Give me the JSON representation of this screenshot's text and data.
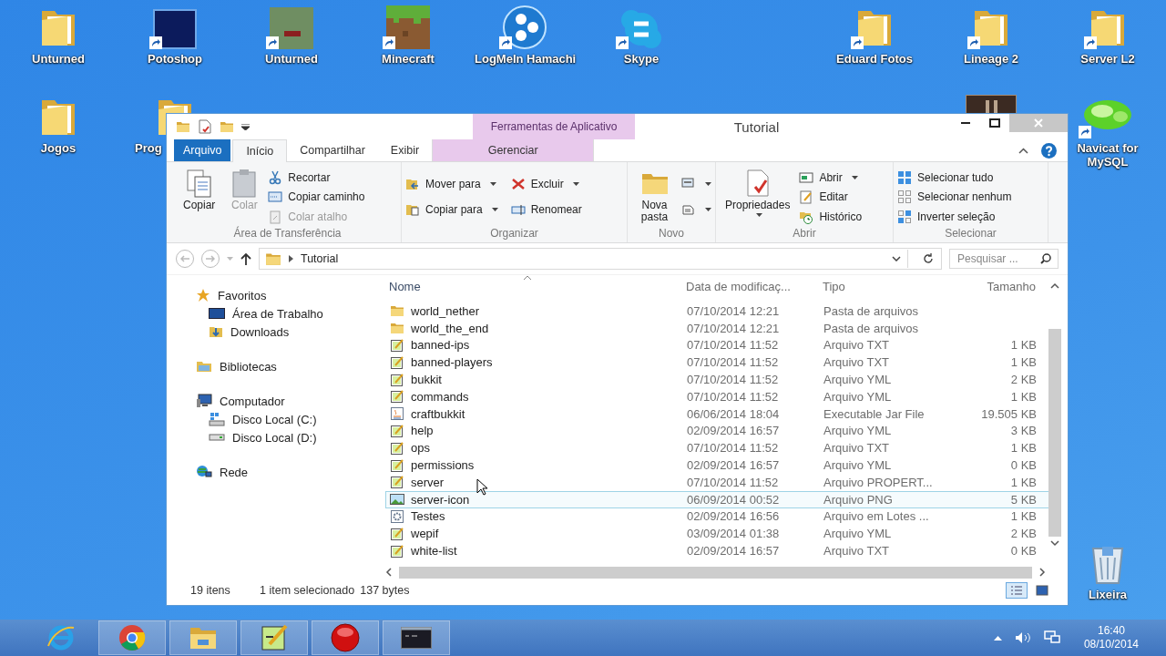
{
  "desktop_icons": [
    {
      "label": "Unturned",
      "kind": "folder",
      "shortcut": false
    },
    {
      "label": "Potoshop",
      "kind": "photoshop",
      "shortcut": true
    },
    {
      "label": "Unturned",
      "kind": "unturned",
      "shortcut": true
    },
    {
      "label": "Minecraft",
      "kind": "minecraft",
      "shortcut": true
    },
    {
      "label": "LogMeIn Hamachi",
      "kind": "hamachi",
      "shortcut": true
    },
    {
      "label": "Skype",
      "kind": "skype",
      "shortcut": true
    },
    {
      "label": "Eduard Fotos",
      "kind": "folder",
      "shortcut": true
    },
    {
      "label": "Lineage 2",
      "kind": "folder",
      "shortcut": true
    },
    {
      "label": "Server L2",
      "kind": "folder",
      "shortcut": true
    },
    {
      "label": "Jogos",
      "kind": "folder",
      "shortcut": false
    },
    {
      "label": "Prog",
      "kind": "folder",
      "shortcut": false
    },
    {
      "kind": "game"
    },
    {
      "label": "Navicat for MySQL",
      "kind": "navicat",
      "shortcut": true
    },
    {
      "label": "Lixeira",
      "kind": "recycle",
      "shortcut": false
    }
  ],
  "window": {
    "title": "Tutorial",
    "context_header": "Ferramentas de Aplicativo",
    "tabs": [
      {
        "label": "Arquivo",
        "kind": "file",
        "selected": false
      },
      {
        "label": "Início",
        "kind": "tab",
        "selected": true
      },
      {
        "label": "Compartilhar",
        "kind": "tab",
        "selected": false
      },
      {
        "label": "Exibir",
        "kind": "tab",
        "selected": false
      },
      {
        "label": "Gerenciar",
        "kind": "context",
        "selected": false
      }
    ],
    "ribbon": [
      {
        "name": "Área de Transferência",
        "items": [
          {
            "label": "Copiar",
            "kind": "large",
            "disabled": false,
            "dropdown": false
          },
          {
            "label": "Colar",
            "kind": "large",
            "disabled": true,
            "dropdown": false
          },
          {
            "label": "Recortar",
            "kind": "small",
            "disabled": false,
            "dropdown": false
          },
          {
            "label": "Copiar caminho",
            "kind": "small",
            "disabled": false,
            "dropdown": false
          },
          {
            "label": "Colar atalho",
            "kind": "small",
            "disabled": true,
            "dropdown": false
          }
        ]
      },
      {
        "name": "Organizar",
        "items": [
          {
            "label": "Mover para",
            "kind": "small",
            "disabled": false,
            "dropdown": true
          },
          {
            "label": "Copiar para",
            "kind": "small",
            "disabled": false,
            "dropdown": true
          },
          {
            "label": "Excluir",
            "kind": "small",
            "disabled": false,
            "dropdown": true
          },
          {
            "label": "Renomear",
            "kind": "small",
            "disabled": false,
            "dropdown": false
          }
        ]
      },
      {
        "name": "Novo",
        "items": [
          {
            "label": "Nova pasta",
            "kind": "large",
            "disabled": false,
            "dropdown": false
          },
          {
            "kind": "icon",
            "disabled": false,
            "dropdown": true
          },
          {
            "kind": "icon",
            "disabled": false,
            "dropdown": true
          }
        ]
      },
      {
        "name": "Abrir",
        "items": [
          {
            "label": "Propriedades",
            "kind": "large",
            "disabled": false,
            "dropdown": true
          },
          {
            "label": "Abrir",
            "kind": "small",
            "disabled": false,
            "dropdown": true
          },
          {
            "label": "Editar",
            "kind": "small",
            "disabled": false,
            "dropdown": false
          },
          {
            "label": "Histórico",
            "kind": "small",
            "disabled": false,
            "dropdown": false
          }
        ]
      },
      {
        "name": "Selecionar",
        "items": [
          {
            "label": "Selecionar tudo",
            "kind": "small",
            "disabled": false,
            "dropdown": false
          },
          {
            "label": "Selecionar nenhum",
            "kind": "small",
            "disabled": false,
            "dropdown": false
          },
          {
            "label": "Inverter seleção",
            "kind": "small",
            "disabled": false,
            "dropdown": false
          }
        ]
      }
    ],
    "address": {
      "path": [
        "Tutorial"
      ],
      "search_placeholder": "Pesquisar ..."
    },
    "navigation": [
      {
        "label": "Favoritos",
        "kind": "favorites",
        "children": [
          {
            "label": "Área de Trabalho",
            "kind": "desktop"
          },
          {
            "label": "Downloads",
            "kind": "downloads"
          }
        ]
      },
      {
        "label": "Bibliotecas",
        "kind": "libraries"
      },
      {
        "label": "Computador",
        "kind": "computer",
        "children": [
          {
            "label": "Disco Local (C:)",
            "kind": "system-drive"
          },
          {
            "label": "Disco Local (D:)",
            "kind": "drive"
          }
        ]
      },
      {
        "label": "Rede",
        "kind": "network"
      }
    ],
    "columns": [
      "Nome",
      "Data de modificaç...",
      "Tipo",
      "Tamanho"
    ],
    "files": [
      {
        "name": "world_nether",
        "date": "07/10/2014 12:21",
        "type": "Pasta de arquivos",
        "kind": "folder",
        "selected": false
      },
      {
        "name": "world_the_end",
        "date": "07/10/2014 12:21",
        "type": "Pasta de arquivos",
        "kind": "folder",
        "selected": false
      },
      {
        "name": "banned-ips",
        "date": "07/10/2014 11:52",
        "type": "Arquivo TXT",
        "size": "1 KB",
        "kind": "text",
        "selected": false
      },
      {
        "name": "banned-players",
        "date": "07/10/2014 11:52",
        "type": "Arquivo TXT",
        "size": "1 KB",
        "kind": "text",
        "selected": false
      },
      {
        "name": "bukkit",
        "date": "07/10/2014 11:52",
        "type": "Arquivo YML",
        "size": "2 KB",
        "kind": "text",
        "selected": false
      },
      {
        "name": "commands",
        "date": "07/10/2014 11:52",
        "type": "Arquivo YML",
        "size": "1 KB",
        "kind": "text",
        "selected": false
      },
      {
        "name": "craftbukkit",
        "date": "06/06/2014 18:04",
        "type": "Executable Jar File",
        "size": "19.505 KB",
        "kind": "jar",
        "selected": false
      },
      {
        "name": "help",
        "date": "02/09/2014 16:57",
        "type": "Arquivo YML",
        "size": "3 KB",
        "kind": "text",
        "selected": false
      },
      {
        "name": "ops",
        "date": "07/10/2014 11:52",
        "type": "Arquivo TXT",
        "size": "1 KB",
        "kind": "text",
        "selected": false
      },
      {
        "name": "permissions",
        "date": "02/09/2014 16:57",
        "type": "Arquivo YML",
        "size": "0 KB",
        "kind": "text",
        "selected": false
      },
      {
        "name": "server",
        "date": "07/10/2014 11:52",
        "type": "Arquivo PROPERT...",
        "size": "1 KB",
        "kind": "text",
        "selected": false
      },
      {
        "name": "server-icon",
        "date": "06/09/2014 00:52",
        "type": "Arquivo PNG",
        "size": "5 KB",
        "kind": "image",
        "selected": true
      },
      {
        "name": "Testes",
        "date": "02/09/2014 16:56",
        "type": "Arquivo em Lotes ...",
        "size": "1 KB",
        "kind": "batch",
        "selected": false
      },
      {
        "name": "wepif",
        "date": "03/09/2014 01:38",
        "type": "Arquivo YML",
        "size": "2 KB",
        "kind": "text",
        "selected": false
      },
      {
        "name": "white-list",
        "date": "02/09/2014 16:57",
        "type": "Arquivo TXT",
        "size": "0 KB",
        "kind": "text",
        "selected": false
      }
    ],
    "status": {
      "item_count": "19 itens",
      "selection": "1 item selecionado",
      "size": "137 bytes"
    },
    "views": [
      {
        "kind": "details",
        "selected": true
      },
      {
        "kind": "large-icons",
        "selected": false
      }
    ]
  },
  "taskbar": {
    "apps": [
      {
        "kind": "ie",
        "running": false
      },
      {
        "kind": "chrome",
        "running": true
      },
      {
        "kind": "explorer",
        "running": true
      },
      {
        "kind": "notepad",
        "running": true
      },
      {
        "kind": "record",
        "running": true
      },
      {
        "kind": "cmd",
        "running": true
      }
    ],
    "time": "16:40",
    "date": "08/10/2014"
  }
}
